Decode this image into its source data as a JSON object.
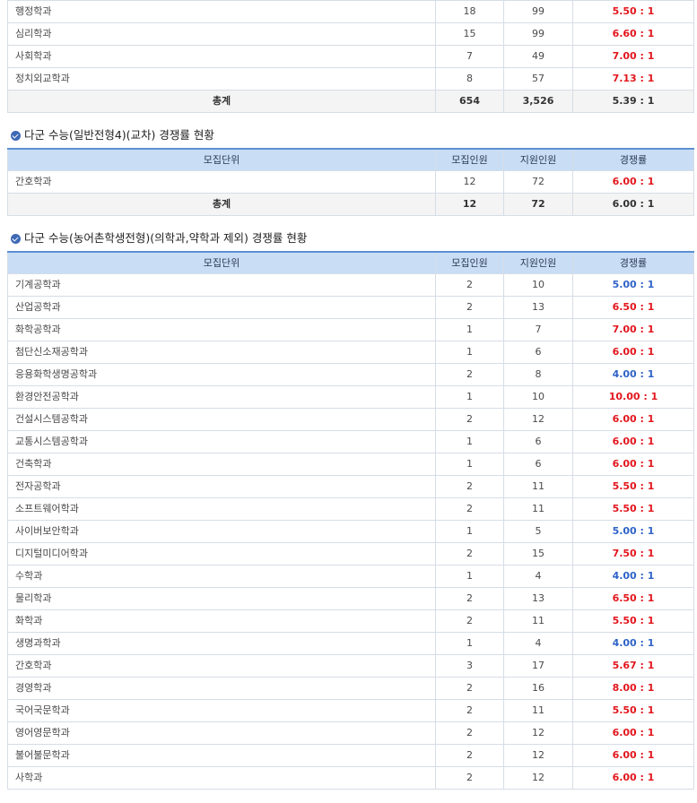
{
  "colors": {
    "blue": "#2f63c8",
    "red": "#e2161d",
    "header_bg": "#c9ddf5"
  },
  "table1": {
    "rows": [
      {
        "unit": "행정학과",
        "recruit": "18",
        "applicants": "99",
        "ratio": "5.50 : 1",
        "color": "red"
      },
      {
        "unit": "심리학과",
        "recruit": "15",
        "applicants": "99",
        "ratio": "6.60 : 1",
        "color": "red"
      },
      {
        "unit": "사회학과",
        "recruit": "7",
        "applicants": "49",
        "ratio": "7.00 : 1",
        "color": "red"
      },
      {
        "unit": "정치외교학과",
        "recruit": "8",
        "applicants": "57",
        "ratio": "7.13 : 1",
        "color": "red"
      }
    ],
    "total": {
      "label": "총계",
      "recruit": "654",
      "applicants": "3,526",
      "ratio": "5.39 : 1"
    }
  },
  "section2": {
    "title": "다군 수능(일반전형4)(교차) 경쟁률 현황",
    "headers": [
      "모집단위",
      "모집인원",
      "지원인원",
      "경쟁률"
    ],
    "rows": [
      {
        "unit": "간호학과",
        "recruit": "12",
        "applicants": "72",
        "ratio": "6.00 : 1",
        "color": "red"
      }
    ],
    "total": {
      "label": "총계",
      "recruit": "12",
      "applicants": "72",
      "ratio": "6.00 : 1"
    }
  },
  "section3": {
    "title": "다군 수능(농어촌학생전형)(의학과,약학과 제외) 경쟁률 현황",
    "headers": [
      "모집단위",
      "모집인원",
      "지원인원",
      "경쟁률"
    ],
    "rows": [
      {
        "unit": "기계공학과",
        "recruit": "2",
        "applicants": "10",
        "ratio": "5.00 : 1",
        "color": "blue"
      },
      {
        "unit": "산업공학과",
        "recruit": "2",
        "applicants": "13",
        "ratio": "6.50 : 1",
        "color": "red"
      },
      {
        "unit": "화학공학과",
        "recruit": "1",
        "applicants": "7",
        "ratio": "7.00 : 1",
        "color": "red"
      },
      {
        "unit": "첨단신소재공학과",
        "recruit": "1",
        "applicants": "6",
        "ratio": "6.00 : 1",
        "color": "red"
      },
      {
        "unit": "응용화학생명공학과",
        "recruit": "2",
        "applicants": "8",
        "ratio": "4.00 : 1",
        "color": "blue"
      },
      {
        "unit": "환경안전공학과",
        "recruit": "1",
        "applicants": "10",
        "ratio": "10.00 : 1",
        "color": "red"
      },
      {
        "unit": "건설시스템공학과",
        "recruit": "2",
        "applicants": "12",
        "ratio": "6.00 : 1",
        "color": "red"
      },
      {
        "unit": "교통시스템공학과",
        "recruit": "1",
        "applicants": "6",
        "ratio": "6.00 : 1",
        "color": "red"
      },
      {
        "unit": "건축학과",
        "recruit": "1",
        "applicants": "6",
        "ratio": "6.00 : 1",
        "color": "red"
      },
      {
        "unit": "전자공학과",
        "recruit": "2",
        "applicants": "11",
        "ratio": "5.50 : 1",
        "color": "red"
      },
      {
        "unit": "소프트웨어학과",
        "recruit": "2",
        "applicants": "11",
        "ratio": "5.50 : 1",
        "color": "red"
      },
      {
        "unit": "사이버보안학과",
        "recruit": "1",
        "applicants": "5",
        "ratio": "5.00 : 1",
        "color": "blue"
      },
      {
        "unit": "디지털미디어학과",
        "recruit": "2",
        "applicants": "15",
        "ratio": "7.50 : 1",
        "color": "red"
      },
      {
        "unit": "수학과",
        "recruit": "1",
        "applicants": "4",
        "ratio": "4.00 : 1",
        "color": "blue"
      },
      {
        "unit": "물리학과",
        "recruit": "2",
        "applicants": "13",
        "ratio": "6.50 : 1",
        "color": "red"
      },
      {
        "unit": "화학과",
        "recruit": "2",
        "applicants": "11",
        "ratio": "5.50 : 1",
        "color": "red"
      },
      {
        "unit": "생명과학과",
        "recruit": "1",
        "applicants": "4",
        "ratio": "4.00 : 1",
        "color": "blue"
      },
      {
        "unit": "간호학과",
        "recruit": "3",
        "applicants": "17",
        "ratio": "5.67 : 1",
        "color": "red"
      },
      {
        "unit": "경영학과",
        "recruit": "2",
        "applicants": "16",
        "ratio": "8.00 : 1",
        "color": "red"
      },
      {
        "unit": "국어국문학과",
        "recruit": "2",
        "applicants": "11",
        "ratio": "5.50 : 1",
        "color": "red"
      },
      {
        "unit": "영어영문학과",
        "recruit": "2",
        "applicants": "12",
        "ratio": "6.00 : 1",
        "color": "red"
      },
      {
        "unit": "불어불문학과",
        "recruit": "2",
        "applicants": "12",
        "ratio": "6.00 : 1",
        "color": "red"
      },
      {
        "unit": "사학과",
        "recruit": "2",
        "applicants": "12",
        "ratio": "6.00 : 1",
        "color": "red"
      }
    ]
  }
}
